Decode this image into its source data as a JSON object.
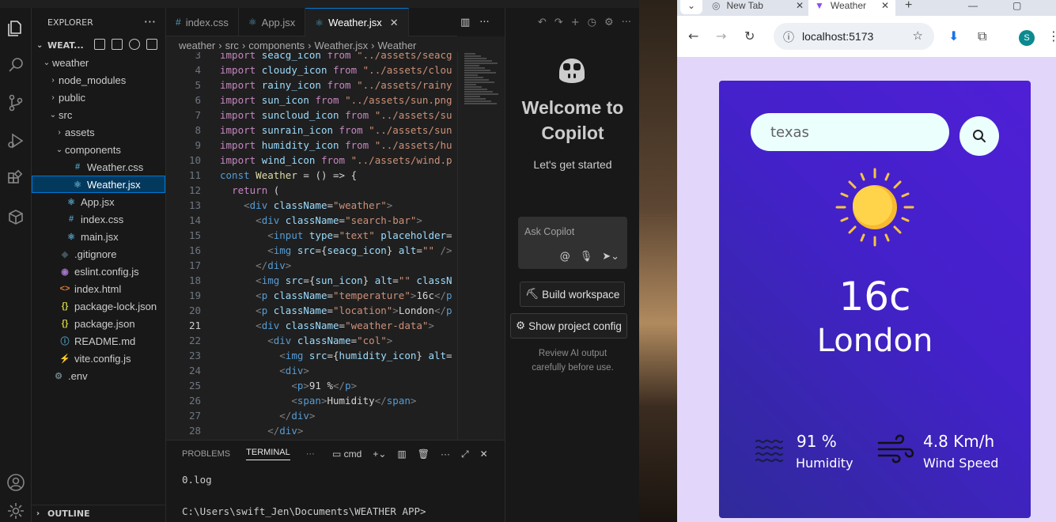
{
  "vscode": {
    "explorer_title": "EXPLORER",
    "project_name": "WEAT...",
    "tree": [
      {
        "label": "weather",
        "chev": "⌄",
        "icon": "",
        "indent": 1,
        "color": "#cccccc"
      },
      {
        "label": "node_modules",
        "chev": "›",
        "icon": "",
        "indent": 2,
        "color": "#cccccc"
      },
      {
        "label": "public",
        "chev": "›",
        "icon": "",
        "indent": 2,
        "color": "#cccccc"
      },
      {
        "label": "src",
        "chev": "⌄",
        "icon": "",
        "indent": 2,
        "color": "#cccccc"
      },
      {
        "label": "assets",
        "chev": "›",
        "icon": "",
        "indent": 3,
        "color": "#cccccc"
      },
      {
        "label": "components",
        "chev": "⌄",
        "icon": "",
        "indent": 3,
        "color": "#cccccc"
      },
      {
        "label": "Weather.css",
        "chev": "",
        "icon": "#",
        "indent": 4,
        "color": "#cccccc",
        "icon_color": "#519aba"
      },
      {
        "label": "Weather.jsx",
        "chev": "",
        "icon": "⚛",
        "indent": 4,
        "color": "#ffffff",
        "icon_color": "#519aba",
        "selected": true
      },
      {
        "label": "App.jsx",
        "chev": "",
        "icon": "⚛",
        "indent": 3,
        "color": "#cccccc",
        "icon_color": "#519aba"
      },
      {
        "label": "index.css",
        "chev": "",
        "icon": "#",
        "indent": 3,
        "color": "#cccccc",
        "icon_color": "#519aba"
      },
      {
        "label": "main.jsx",
        "chev": "",
        "icon": "⚛",
        "indent": 3,
        "color": "#cccccc",
        "icon_color": "#519aba"
      },
      {
        "label": ".gitignore",
        "chev": "",
        "icon": "◆",
        "indent": 2,
        "color": "#cccccc",
        "icon_color": "#41535b"
      },
      {
        "label": "eslint.config.js",
        "chev": "",
        "icon": "◉",
        "indent": 2,
        "color": "#cccccc",
        "icon_color": "#a074c4"
      },
      {
        "label": "index.html",
        "chev": "",
        "icon": "<>",
        "indent": 2,
        "color": "#cccccc",
        "icon_color": "#e37933"
      },
      {
        "label": "package-lock.json",
        "chev": "",
        "icon": "{}",
        "indent": 2,
        "color": "#cccccc",
        "icon_color": "#cbcb41"
      },
      {
        "label": "package.json",
        "chev": "",
        "icon": "{}",
        "indent": 2,
        "color": "#cccccc",
        "icon_color": "#cbcb41"
      },
      {
        "label": "README.md",
        "chev": "",
        "icon": "ⓘ",
        "indent": 2,
        "color": "#cccccc",
        "icon_color": "#519aba"
      },
      {
        "label": "vite.config.js",
        "chev": "",
        "icon": "⚡",
        "indent": 2,
        "color": "#cccccc",
        "icon_color": "#cbcb41"
      },
      {
        "label": ".env",
        "chev": "",
        "icon": "⚙",
        "indent": 1,
        "color": "#cccccc",
        "icon_color": "#6d8086"
      }
    ],
    "outline_label": "OUTLINE",
    "tabs": [
      {
        "label": "index.css",
        "icon": "#",
        "active": false
      },
      {
        "label": "App.jsx",
        "icon": "⚛",
        "active": false
      },
      {
        "label": "Weather.jsx",
        "icon": "⚛",
        "active": true
      }
    ],
    "breadcrumb": [
      "weather",
      "src",
      "components",
      "Weather.jsx",
      "Weather"
    ],
    "code_lines": [
      {
        "n": "3",
        "html": "<span class='k'>import</span> <span class='v'>seacg_icon</span> <span class='k'>from</span> <span class='s'>\"../assets/seacg</span>"
      },
      {
        "n": "4",
        "html": "<span class='k'>import</span> <span class='v'>cloudy_icon</span> <span class='k'>from</span> <span class='s'>\"../assets/clou</span>"
      },
      {
        "n": "5",
        "html": "<span class='k'>import</span> <span class='v'>rainy_icon</span> <span class='k'>from</span> <span class='s'>\"../assets/rainy</span>"
      },
      {
        "n": "6",
        "html": "<span class='k'>import</span> <span class='v'>sun_icon</span> <span class='k'>from</span> <span class='s'>\"../assets/sun.png</span>"
      },
      {
        "n": "7",
        "html": "<span class='k'>import</span> <span class='v'>suncloud_icon</span> <span class='k'>from</span> <span class='s'>\"../assets/su</span>"
      },
      {
        "n": "8",
        "html": "<span class='k'>import</span> <span class='v'>sunrain_icon</span> <span class='k'>from</span> <span class='s'>\"../assets/sun</span>"
      },
      {
        "n": "9",
        "html": "<span class='k'>import</span> <span class='v'>humidity_icon</span> <span class='k'>from</span> <span class='s'>\"../assets/hu</span>"
      },
      {
        "n": "10",
        "html": "<span class='k'>import</span> <span class='v'>wind_icon</span> <span class='k'>from</span> <span class='s'>\"../assets/wind.p</span>"
      },
      {
        "n": "11",
        "html": "<span class='t'>const</span> <span class='y'>Weather</span> <span class='d'>= () =&gt; {</span>"
      },
      {
        "n": "12",
        "html": "  <span class='k'>return</span> <span class='d'>(</span>"
      },
      {
        "n": "13",
        "html": "    <span class='g'>&lt;</span><span class='t'>div</span> <span class='v'>className</span><span class='d'>=</span><span class='s'>\"weather\"</span><span class='g'>&gt;</span>"
      },
      {
        "n": "14",
        "html": "      <span class='g'>&lt;</span><span class='t'>div</span> <span class='v'>className</span><span class='d'>=</span><span class='s'>\"search-bar\"</span><span class='g'>&gt;</span>"
      },
      {
        "n": "15",
        "html": "        <span class='g'>&lt;</span><span class='t'>input</span> <span class='v'>type</span><span class='d'>=</span><span class='s'>\"text\"</span> <span class='v'>placeholder</span><span class='d'>=</span>"
      },
      {
        "n": "16",
        "html": "        <span class='g'>&lt;</span><span class='t'>img</span> <span class='v'>src</span><span class='d'>={</span><span class='v'>seacg_icon</span><span class='d'>}</span> <span class='v'>alt</span><span class='d'>=</span><span class='s'>\"\"</span> <span class='g'>/&gt;</span>"
      },
      {
        "n": "17",
        "html": "      <span class='g'>&lt;/</span><span class='t'>div</span><span class='g'>&gt;</span>"
      },
      {
        "n": "18",
        "html": "      <span class='g'>&lt;</span><span class='t'>img</span> <span class='v'>src</span><span class='d'>={</span><span class='v'>sun_icon</span><span class='d'>}</span> <span class='v'>alt</span><span class='d'>=</span><span class='s'>\"\"</span> <span class='v'>classN</span>"
      },
      {
        "n": "19",
        "html": "      <span class='g'>&lt;</span><span class='t'>p</span> <span class='v'>className</span><span class='d'>=</span><span class='s'>\"temperature\"</span><span class='g'>&gt;</span><span class='d'>16c</span><span class='g'>&lt;/</span><span class='t'>p</span>"
      },
      {
        "n": "20",
        "html": "      <span class='g'>&lt;</span><span class='t'>p</span> <span class='v'>className</span><span class='d'>=</span><span class='s'>\"location\"</span><span class='g'>&gt;</span><span class='d'>London</span><span class='g'>&lt;/</span><span class='t'>p</span>"
      },
      {
        "n": "21",
        "html": "      <span class='g'>&lt;</span><span class='t'>div</span> <span class='v'>className</span><span class='d'>=</span><span class='s'>\"weather-data\"</span><span class='g'>&gt;</span>",
        "current": true
      },
      {
        "n": "22",
        "html": "        <span class='g'>&lt;</span><span class='t'>div</span> <span class='v'>className</span><span class='d'>=</span><span class='s'>\"col\"</span><span class='g'>&gt;</span>"
      },
      {
        "n": "23",
        "html": "          <span class='g'>&lt;</span><span class='t'>img</span> <span class='v'>src</span><span class='d'>={</span><span class='v'>humidity_icon</span><span class='d'>}</span> <span class='v'>alt</span><span class='d'>=</span>"
      },
      {
        "n": "24",
        "html": "          <span class='g'>&lt;</span><span class='t'>div</span><span class='g'>&gt;</span>"
      },
      {
        "n": "25",
        "html": "            <span class='g'>&lt;</span><span class='t'>p</span><span class='g'>&gt;</span><span class='d'>91 %</span><span class='g'>&lt;/</span><span class='t'>p</span><span class='g'>&gt;</span>"
      },
      {
        "n": "26",
        "html": "            <span class='g'>&lt;</span><span class='t'>span</span><span class='g'>&gt;</span><span class='d'>Humidity</span><span class='g'>&lt;/</span><span class='t'>span</span><span class='g'>&gt;</span>"
      },
      {
        "n": "27",
        "html": "          <span class='g'>&lt;/</span><span class='t'>div</span><span class='g'>&gt;</span>"
      },
      {
        "n": "28",
        "html": "        <span class='g'>&lt;/</span><span class='t'>div</span><span class='g'>&gt;</span>"
      }
    ],
    "panel": {
      "tabs": [
        "PROBLEMS",
        "TERMINAL"
      ],
      "active_tab": "TERMINAL",
      "shell": "cmd",
      "lines": [
        "0.log",
        "",
        "C:\\Users\\swift_Jen\\Documents\\WEATHER APP>"
      ]
    },
    "copilot": {
      "title": "Welcome to Copilot",
      "subtitle": "Let's get started",
      "input_placeholder": "Ask Copilot",
      "build_button": "Build workspace",
      "config_button": "Show project config",
      "note": "Review AI output carefully before use."
    }
  },
  "browser": {
    "tabs": [
      {
        "label": "New Tab",
        "active": false
      },
      {
        "label": "Weather",
        "active": true
      }
    ],
    "url": "localhost:5173",
    "avatar_letter": "S",
    "app": {
      "search_value": "texas",
      "temperature": "16c",
      "location": "London",
      "humidity_value": "91 %",
      "humidity_label": "Humidity",
      "wind_value": "4.8 Km/h",
      "wind_label": "Wind Speed"
    }
  }
}
